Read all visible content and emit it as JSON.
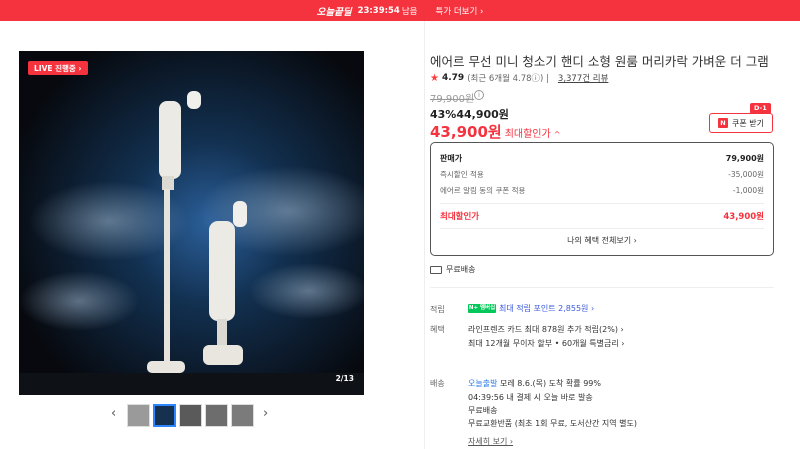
{
  "topbar": {
    "brand": "오늘끝딜",
    "timer": "23:39:54",
    "remain": "남음",
    "more": "특가 더보기 ›"
  },
  "media": {
    "live": "LIVE 진행중 ›",
    "counter": "2/13",
    "prev": "‹",
    "next": "›"
  },
  "product": {
    "title": "에어르 무선 미니 청소기 핸디 소형 원룸 머리카락 가벼운 더 그램",
    "star": "★",
    "score": "4.79",
    "score_detail": "(최근 6개월 4.78ⓘ) |",
    "reviews": "3,377건 리뷰",
    "original_price": "79,900원",
    "sale_line": "43%44,900원",
    "max_price": "43,900원",
    "max_label": "최대할인가",
    "max_caret": "^",
    "coupon_badge": "D-1",
    "coupon_n": "N",
    "coupon_label": "쿠폰 받기"
  },
  "pricebox": {
    "row1": {
      "label": "판매가",
      "value": "79,900원"
    },
    "row2": {
      "label": "즉시할인 적용",
      "value": "-35,000원"
    },
    "row3": {
      "label": "에어르 알림 동의 쿠폰 적용",
      "value": "-1,000원"
    },
    "row4": {
      "label": "최대할인가",
      "value": "43,900원"
    },
    "all_benefits": "나의 혜택 전체보기 ›"
  },
  "shipping_free": "무료배송",
  "points": {
    "label": "적립",
    "npay": "N+ 멤버십",
    "text": "최대 적립 포인트 2,855원 ›"
  },
  "benefits": {
    "label": "혜택",
    "line1": "라인프렌즈 카드 최대 878원 추가 적립(2%) ›",
    "line2": "최대 12개월 무이자 할부 • 60개월 특별금리 ›"
  },
  "delivery": {
    "label": "배송",
    "today": "오늘출발",
    "line1_rest": " 모레 8.6.(목) 도착 확률 99%",
    "line2": "04:39:56  내 결제 시 오늘 바로 발송",
    "line3": "무료배송",
    "line4": "무료교환반품 (최초 1회 무료, 도서산간 지역 별도)",
    "more": "자세히 보기 ›"
  },
  "colors": {
    "accent": "#f5333f",
    "blue": "#2b7be4"
  }
}
